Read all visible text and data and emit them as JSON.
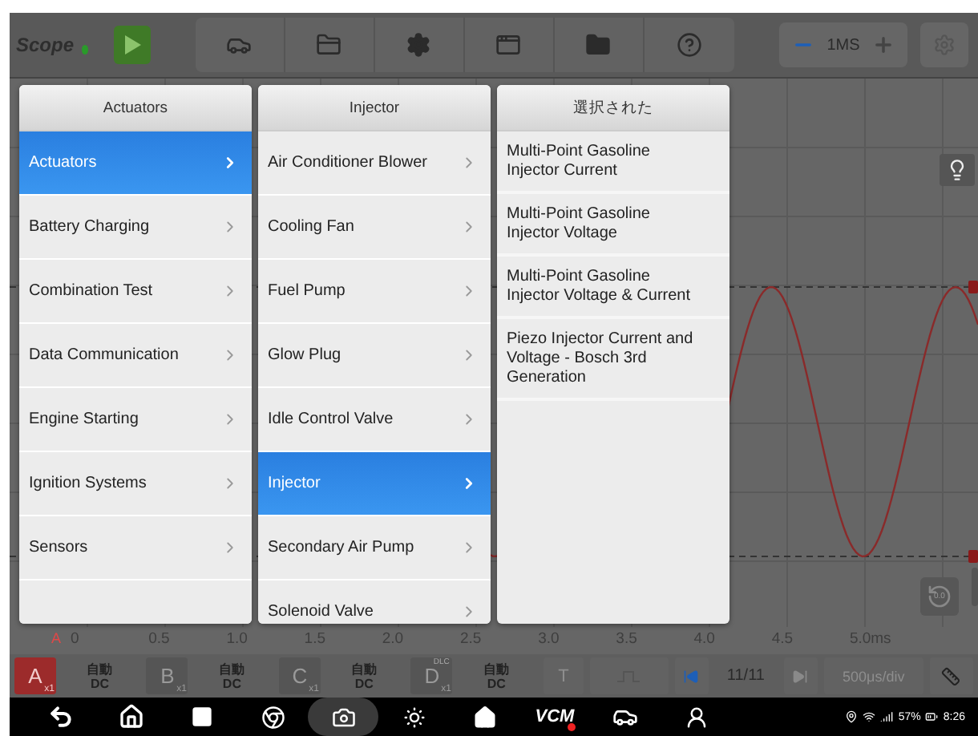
{
  "toolbar": {
    "title": "Scope",
    "scale": "1MS"
  },
  "menus": [
    {
      "title": "Actuators",
      "kind": "submenu",
      "items": [
        {
          "label": "Actuators",
          "selected": true
        },
        {
          "label": "Battery Charging",
          "selected": false
        },
        {
          "label": "Combination Test",
          "selected": false
        },
        {
          "label": "Data Communication",
          "selected": false
        },
        {
          "label": "Engine Starting",
          "selected": false
        },
        {
          "label": "Ignition Systems",
          "selected": false
        },
        {
          "label": "Sensors",
          "selected": false
        }
      ]
    },
    {
      "title": "Injector",
      "kind": "submenu",
      "items": [
        {
          "label": "Air Conditioner Blower",
          "selected": false
        },
        {
          "label": "Cooling Fan",
          "selected": false
        },
        {
          "label": "Fuel Pump",
          "selected": false
        },
        {
          "label": "Glow Plug",
          "selected": false
        },
        {
          "label": "Idle Control Valve",
          "selected": false
        },
        {
          "label": "Injector",
          "selected": true
        },
        {
          "label": "Secondary Air Pump",
          "selected": false
        },
        {
          "label": "Solenoid Valve",
          "selected": false
        }
      ]
    },
    {
      "title": "選択された",
      "kind": "leaf",
      "items": [
        {
          "label": "Multi-Point Gasoline Injector Current",
          "selected": false
        },
        {
          "label": "Multi-Point Gasoline Injector Voltage",
          "selected": false
        },
        {
          "label": "Multi-Point Gasoline Injector Voltage & Current",
          "selected": false
        },
        {
          "label": "Piezo Injector Current and Voltage - Bosch 3rd Generation",
          "selected": false
        }
      ]
    }
  ],
  "axis": {
    "channel": "A",
    "ticks": [
      "0",
      "0.5",
      "1.0",
      "1.5",
      "2.0",
      "2.5",
      "3.0",
      "3.5",
      "4.0",
      "4.5",
      "5.0ms"
    ]
  },
  "channels": [
    {
      "name": "A",
      "selected": true,
      "gain": "x1",
      "mode": "自動",
      "coupling": "DC"
    },
    {
      "name": "B",
      "selected": false,
      "gain": "x1",
      "mode": "自動",
      "coupling": "DC"
    },
    {
      "name": "C",
      "selected": false,
      "gain": "x1",
      "mode": "自動",
      "coupling": "DC"
    },
    {
      "name": "D",
      "selected": false,
      "gain": "x1",
      "badge": "DLC",
      "mode": "自動",
      "coupling": "DC"
    }
  ],
  "trigger": "T",
  "page": "11/11",
  "timebase": "500μs/div",
  "reset": "0.0",
  "nav": {
    "vcm": "VCM"
  },
  "status": {
    "battery": "57%",
    "time": "8:26"
  }
}
